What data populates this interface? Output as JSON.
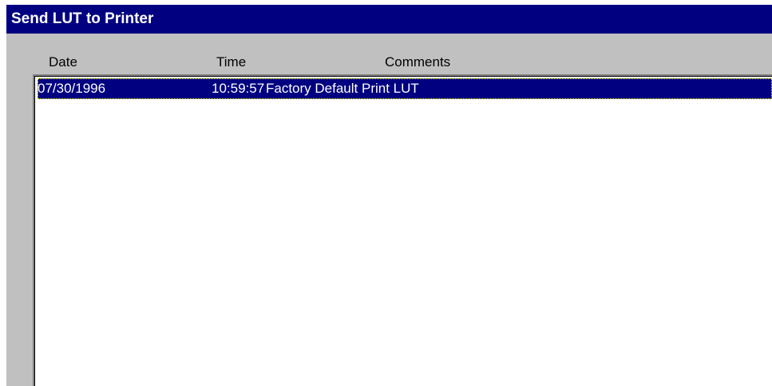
{
  "window": {
    "title": "Send LUT to Printer"
  },
  "list": {
    "columns": [
      "Date",
      "Time",
      "Comments"
    ],
    "rows": [
      {
        "date": "07/30/1996",
        "time": "10:59:57",
        "comments": "Factory Default Print LUT",
        "selected": true
      }
    ]
  },
  "colors": {
    "title_bar": "#000080",
    "selection": "#000080",
    "dialog_face": "#c0c0c0",
    "list_background": "#ffffff"
  }
}
